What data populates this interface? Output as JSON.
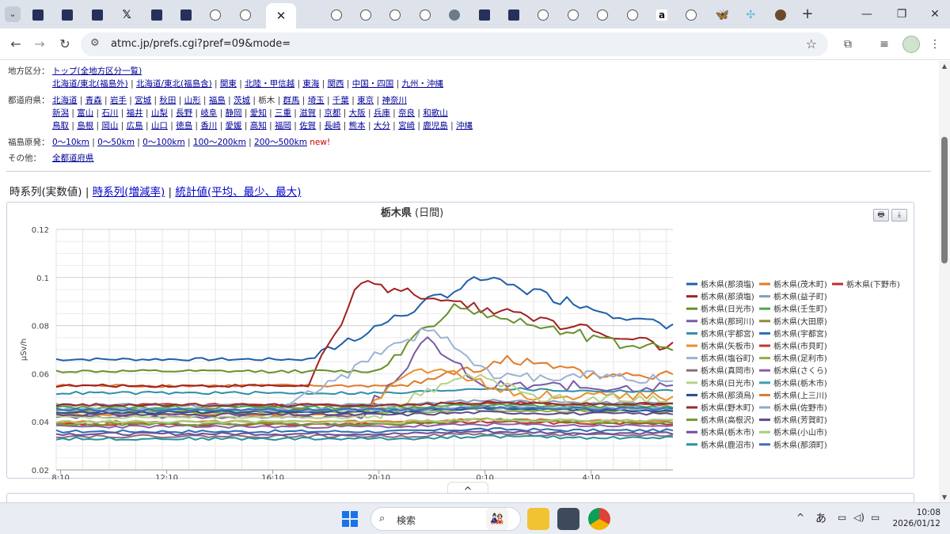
{
  "browser": {
    "url": "atmc.jp/prefs.cgi?pref=09&mode=",
    "active_tab_close": "✕",
    "tab_icons": [
      "s",
      "s",
      "s",
      "x",
      "s",
      "s",
      "o",
      "o",
      "o",
      "o",
      "o",
      "o",
      "o",
      "g",
      "s",
      "s",
      "o",
      "o",
      "o",
      "o",
      "a",
      "o",
      "b",
      "c",
      "h"
    ]
  },
  "nav": {
    "region": {
      "label": "地方区分：",
      "links": [
        [
          "トップ(全地方区分一覧)"
        ],
        [
          "北海道/東北(福島外)",
          "北海道/東北(福島含)",
          "関東",
          "北陸・甲信越",
          "東海",
          "関西",
          "中国・四国",
          "九州・沖縄"
        ]
      ]
    },
    "pref": {
      "label": "都道府県：",
      "current": "栃木",
      "rows": [
        [
          "北海道",
          "青森",
          "岩手",
          "宮城",
          "秋田",
          "山形",
          "福島",
          "茨城",
          "栃木",
          "群馬",
          "埼玉",
          "千葉",
          "東京",
          "神奈川"
        ],
        [
          "新潟",
          "富山",
          "石川",
          "福井",
          "山梨",
          "長野",
          "岐阜",
          "静岡",
          "愛知",
          "三重",
          "滋賀",
          "京都",
          "大阪",
          "兵庫",
          "奈良",
          "和歌山"
        ],
        [
          "鳥取",
          "島根",
          "岡山",
          "広島",
          "山口",
          "徳島",
          "香川",
          "愛媛",
          "高知",
          "福岡",
          "佐賀",
          "長崎",
          "熊本",
          "大分",
          "宮崎",
          "鹿児島",
          "沖縄"
        ]
      ]
    },
    "fukushima": {
      "label": "福島原発：",
      "links": [
        "0〜10km",
        "0〜50km",
        "0〜100km",
        "100〜200km",
        "200〜500km"
      ],
      "new_badge": "new!"
    },
    "other": {
      "label": "その他：",
      "links": [
        "全都道府県"
      ]
    }
  },
  "modes": {
    "current": "時系列(実数値)",
    "links": [
      "時系列(増減率)",
      "統計値(平均、最少、最大)"
    ]
  },
  "chart_data": {
    "type": "line",
    "title": "栃木県",
    "subtitle": "(日間)",
    "ylabel": "µSv/h",
    "xlabel": "",
    "ylim": [
      0.02,
      0.12
    ],
    "yticks": [
      "0.02",
      "0.04",
      "0.06",
      "0.08",
      "0.1",
      "0.12"
    ],
    "x_start_hour": 8.0,
    "x_end_hour": 31.25,
    "xticks": [
      {
        "label": "8:10",
        "h": 8.1667
      },
      {
        "label": "12:10",
        "h": 12.1667
      },
      {
        "label": "16:10",
        "h": 16.1667
      },
      {
        "label": "20:10",
        "h": 20.1667
      },
      {
        "label": "0:10",
        "h": 24.1667
      },
      {
        "label": "4:10",
        "h": 28.1667
      }
    ],
    "grid": true,
    "legend_position": "right",
    "series": [
      {
        "name": "栃木県(那須塩)",
        "color": "#1f5fa8",
        "base": 0.066,
        "peak": 0.1,
        "rise": 17.5,
        "top": 24.0,
        "fall": 31.0
      },
      {
        "name": "栃木県(茂木町)",
        "color": "#e07b2a",
        "base": 0.055,
        "peak": 0.066,
        "rise": 21.0,
        "top": 25.0,
        "fall": 28.0
      },
      {
        "name": "栃木県(下野市)",
        "color": "#b8312f",
        "base": 0.047,
        "peak": 0.048,
        "rise": 21.0,
        "top": 24.0,
        "fall": 28.0
      },
      {
        "name": "栃木県(那須塩)",
        "color": "#a32020",
        "base": 0.055,
        "peak": 0.098,
        "rise": 17.5,
        "top": 19.5,
        "fall": 30.8
      },
      {
        "name": "栃木県(益子町)",
        "color": "#7f9fbf",
        "base": 0.047,
        "peak": 0.049,
        "rise": 21.0,
        "top": 24.0,
        "fall": 28.0
      },
      {
        "name": "栃木県(日光市)",
        "color": "#6a8f2a",
        "base": 0.061,
        "peak": 0.088,
        "rise": 20.0,
        "top": 23.0,
        "fall": 29.5
      },
      {
        "name": "栃木県(壬生町)",
        "color": "#4da64d",
        "base": 0.046,
        "peak": 0.047,
        "rise": 21.0,
        "top": 24.0,
        "fall": 28.0
      },
      {
        "name": "栃木県(那珂川)",
        "color": "#7b5aa6",
        "base": 0.042,
        "peak": 0.074,
        "rise": 19.5,
        "top": 22.0,
        "fall": 24.0
      },
      {
        "name": "栃木県(大田原)",
        "color": "#8a8a3a",
        "base": 0.045,
        "peak": 0.046,
        "rise": 21.0,
        "top": 24.0,
        "fall": 28.0
      },
      {
        "name": "栃木県(宇都宮)",
        "color": "#2f8fa8",
        "base": 0.052,
        "peak": 0.054,
        "rise": 21.0,
        "top": 24.0,
        "fall": 28.0
      },
      {
        "name": "栃木県(宇都宮)",
        "color": "#2a6fb0",
        "base": 0.036,
        "peak": 0.037,
        "rise": 21.0,
        "top": 24.0,
        "fall": 28.0
      },
      {
        "name": "栃木県(矢板市)",
        "color": "#e8902a",
        "base": 0.043,
        "peak": 0.063,
        "rise": 19.5,
        "top": 21.5,
        "fall": 26.0
      },
      {
        "name": "栃木県(市貝町)",
        "color": "#c0392b",
        "base": 0.039,
        "peak": 0.04,
        "rise": 21.0,
        "top": 24.0,
        "fall": 28.0
      },
      {
        "name": "栃木県(塩谷町)",
        "color": "#9bb3d4",
        "base": 0.045,
        "peak": 0.079,
        "rise": 16.5,
        "top": 22.0,
        "fall": 24.5
      },
      {
        "name": "栃木県(足利市)",
        "color": "#8fb040",
        "base": 0.044,
        "peak": 0.045,
        "rise": 21.0,
        "top": 24.0,
        "fall": 28.0
      },
      {
        "name": "栃木県(真岡市)",
        "color": "#8c6d7a",
        "base": 0.034,
        "peak": 0.035,
        "rise": 21.0,
        "top": 24.0,
        "fall": 28.0
      },
      {
        "name": "栃木県(さくら)",
        "color": "#8e5ea6",
        "base": 0.038,
        "peak": 0.039,
        "rise": 21.0,
        "top": 24.0,
        "fall": 28.0
      },
      {
        "name": "栃木県(日光市)",
        "color": "#b6d38a",
        "base": 0.042,
        "peak": 0.06,
        "rise": 20.0,
        "top": 23.5,
        "fall": 26.5
      },
      {
        "name": "栃木県(栃木市)",
        "color": "#3fa0b0",
        "base": 0.045,
        "peak": 0.046,
        "rise": 21.0,
        "top": 24.0,
        "fall": 28.0
      },
      {
        "name": "栃木県(那須烏)",
        "color": "#244f8a",
        "base": 0.044,
        "peak": 0.046,
        "rise": 21.0,
        "top": 24.0,
        "fall": 28.0
      },
      {
        "name": "栃木県(上三川)",
        "color": "#d97b35",
        "base": 0.04,
        "peak": 0.041,
        "rise": 21.0,
        "top": 24.0,
        "fall": 28.0
      },
      {
        "name": "栃木県(野木町)",
        "color": "#9a2a2a",
        "base": 0.047,
        "peak": 0.048,
        "rise": 21.0,
        "top": 24.0,
        "fall": 28.0
      },
      {
        "name": "栃木県(佐野市)",
        "color": "#8ea8cf",
        "base": 0.045,
        "peak": 0.046,
        "rise": 21.0,
        "top": 24.0,
        "fall": 28.0
      },
      {
        "name": "栃木県(高根沢)",
        "color": "#6f9a30",
        "base": 0.039,
        "peak": 0.041,
        "rise": 21.0,
        "top": 24.0,
        "fall": 28.0
      },
      {
        "name": "栃木県(芳賀町)",
        "color": "#5e4a8a",
        "base": 0.043,
        "peak": 0.044,
        "rise": 21.0,
        "top": 24.0,
        "fall": 28.0
      },
      {
        "name": "栃木県(栃木市)",
        "color": "#6f4e9c",
        "base": 0.035,
        "peak": 0.036,
        "rise": 21.0,
        "top": 24.0,
        "fall": 28.0
      },
      {
        "name": "栃木県(小山市)",
        "color": "#a9cc7e",
        "base": 0.04,
        "peak": 0.041,
        "rise": 21.0,
        "top": 24.0,
        "fall": 28.0
      },
      {
        "name": "栃木県(鹿沼市)",
        "color": "#2890a0",
        "base": 0.033,
        "peak": 0.034,
        "rise": 21.0,
        "top": 24.0,
        "fall": 28.0
      },
      {
        "name": "栃木県(那須町)",
        "color": "#3d6db4",
        "base": 0.045,
        "peak": 0.046,
        "rise": 21.0,
        "top": 24.0,
        "fall": 28.0
      }
    ]
  },
  "scroll_hint": "^",
  "taskbar": {
    "search_placeholder": "検索",
    "ime": "あ",
    "time": "10:08",
    "date": "2026/01/12"
  }
}
